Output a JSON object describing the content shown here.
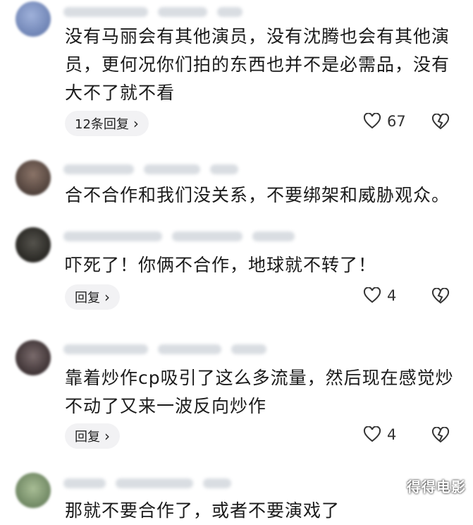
{
  "comments": [
    {
      "text": "没有马丽会有其他演员，没有沈腾也会有其他演员，更何况你们拍的东西也并不是必需品，没有大不了就不看",
      "reply_label": "12条回复",
      "likes": "67",
      "avatar_color": "#7f94c2"
    },
    {
      "text": "合不合作和我们没关系，不要绑架和威胁观众。",
      "avatar_color": "#6b5a52"
    },
    {
      "text": "吓死了！你俩不合作，地球就不转了！",
      "reply_label": "回复",
      "likes": "4",
      "avatar_color": "#3b3a36"
    },
    {
      "text": "靠着炒作cp吸引了这么多流量，然后现在感觉炒不动了又来一波反向炒作",
      "reply_label": "回复",
      "likes": "4",
      "avatar_color": "#54484a"
    },
    {
      "text": "那就不要合作了，或者不要演戏了",
      "avatar_color": "#8aa07a"
    }
  ],
  "watermark": "得得电影",
  "icons": {
    "like": "heart-outline-icon",
    "dislike": "broken-heart-icon",
    "more": "chevron-right-icon"
  }
}
